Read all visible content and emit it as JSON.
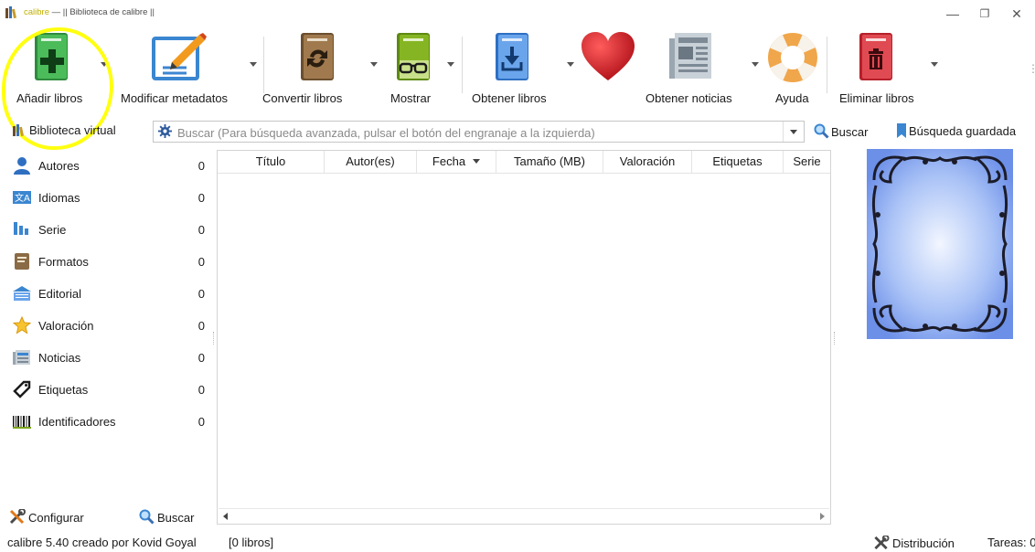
{
  "window": {
    "title_app": "calibre",
    "title_rest": " — || Biblioteca de calibre ||",
    "minimize": "—",
    "maximize": "❐",
    "close": "✕"
  },
  "toolbar": {
    "add_books": "Añadir libros",
    "edit_metadata": "Modificar metadatos",
    "convert_books": "Convertir libros",
    "view": "Mostrar",
    "get_books": "Obtener libros",
    "fetch_news": "Obtener noticias",
    "help": "Ayuda",
    "remove_books": "Eliminar libros",
    "overflow": "⋮"
  },
  "search": {
    "virtual_library": "Biblioteca virtual",
    "placeholder": "Buscar (Para búsqueda avanzada, pulsar el botón del engranaje a la izquierda)",
    "search_button": "Buscar",
    "saved_search": "Búsqueda guardada"
  },
  "tag_browser": {
    "items": [
      {
        "label": "Autores",
        "count": "0",
        "icon": "authors-icon"
      },
      {
        "label": "Idiomas",
        "count": "0",
        "icon": "languages-icon"
      },
      {
        "label": "Serie",
        "count": "0",
        "icon": "series-icon"
      },
      {
        "label": "Formatos",
        "count": "0",
        "icon": "formats-icon"
      },
      {
        "label": "Editorial",
        "count": "0",
        "icon": "publisher-icon"
      },
      {
        "label": "Valoración",
        "count": "0",
        "icon": "rating-star-icon"
      },
      {
        "label": "Noticias",
        "count": "0",
        "icon": "news-icon"
      },
      {
        "label": "Etiquetas",
        "count": "0",
        "icon": "tags-icon"
      },
      {
        "label": "Identificadores",
        "count": "0",
        "icon": "barcode-icon"
      }
    ],
    "configure": "Configurar",
    "find": "Buscar"
  },
  "book_list": {
    "columns": [
      "Título",
      "Autor(es)",
      "Fecha",
      "Tamaño (MB)",
      "Valoración",
      "Etiquetas",
      "Serie"
    ],
    "sorted_column": "Fecha",
    "rows": []
  },
  "status_bar": {
    "version": "calibre 5.40 creado por Kovid Goyal",
    "book_count": "[0 libros]",
    "layout": "Distribución",
    "jobs": "Tareas: 0"
  },
  "colors": {
    "add": "#3aa64a",
    "edit": "#3b86d1",
    "convert": "#8b6b45",
    "view": "#7aa51a",
    "get": "#4a8ee0",
    "heart": "#d4141d",
    "remove": "#d8343c",
    "highlight": "#ffff10"
  }
}
